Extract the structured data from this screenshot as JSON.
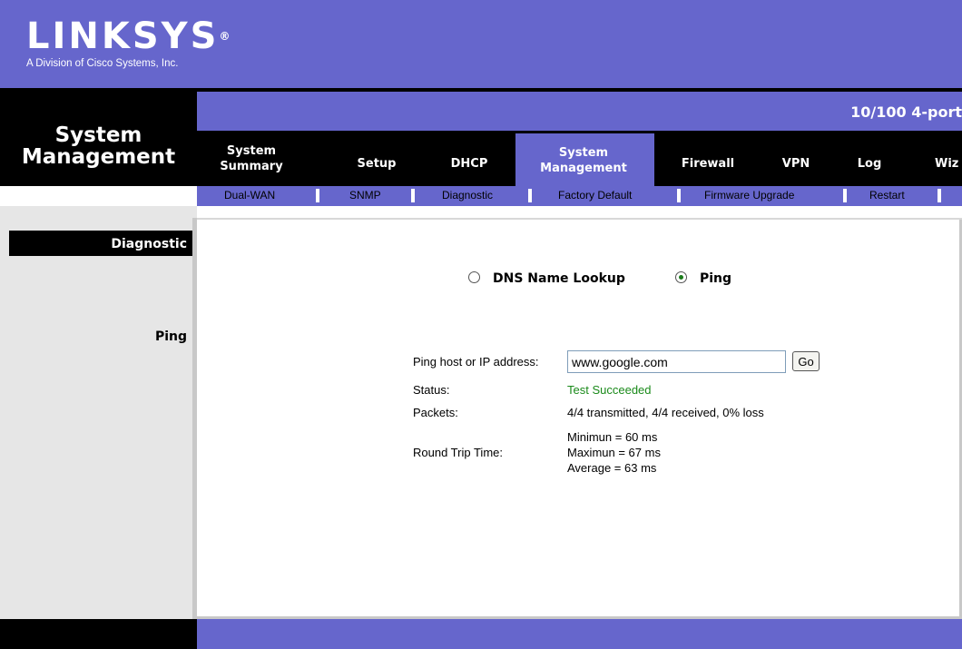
{
  "brand": {
    "logo": "LINKSYS",
    "reg": "®",
    "subtitle": "A Division of Cisco Systems, Inc."
  },
  "page_title": "System Management",
  "product_name": "10/100 4-port",
  "tabs": [
    {
      "label": "System Summary",
      "active": false
    },
    {
      "label": "Setup",
      "active": false
    },
    {
      "label": "DHCP",
      "active": false
    },
    {
      "label": "System Management",
      "active": true
    },
    {
      "label": "Firewall",
      "active": false
    },
    {
      "label": "VPN",
      "active": false
    },
    {
      "label": "Log",
      "active": false
    },
    {
      "label": "Wiz",
      "active": false
    }
  ],
  "subnav": [
    {
      "label": "Dual-WAN"
    },
    {
      "label": "SNMP"
    },
    {
      "label": "Diagnostic"
    },
    {
      "label": "Factory Default"
    },
    {
      "label": "Firmware Upgrade"
    },
    {
      "label": "Restart"
    }
  ],
  "sidebar": {
    "section": "Diagnostic",
    "subsection": "Ping"
  },
  "diagnostic": {
    "mode_options": [
      {
        "label": "DNS Name Lookup",
        "selected": false
      },
      {
        "label": "Ping",
        "selected": true
      }
    ],
    "host_label": "Ping host or IP address:",
    "host_value": "www.google.com",
    "go_label": "Go",
    "status_label": "Status:",
    "status_value": "Test Succeeded",
    "packets_label": "Packets:",
    "packets_value": "4/4 transmitted, 4/4 received, 0% loss",
    "rtt_label": "Round Trip Time:",
    "rtt_min": "Minimun = 60 ms",
    "rtt_max": "Maximun = 67 ms",
    "rtt_avg": "Average = 63 ms"
  },
  "colors": {
    "brand_purple": "#6666cc",
    "status_green": "#1a8a1a"
  }
}
